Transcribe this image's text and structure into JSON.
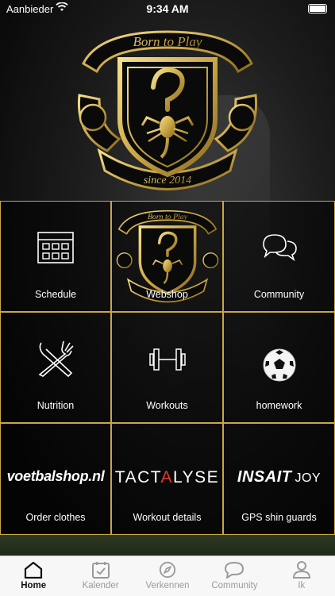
{
  "status_bar": {
    "carrier": "Aanbieder",
    "time": "9:34 AM"
  },
  "hero": {
    "logo_top_text": "Born to Play",
    "logo_bottom_text": "since 2014"
  },
  "tiles": [
    {
      "label": "Schedule",
      "icon": "calendar-icon"
    },
    {
      "label": "Webshop",
      "icon": "club-logo"
    },
    {
      "label": "Community",
      "icon": "chat-bubbles-icon"
    },
    {
      "label": "Nutrition",
      "icon": "fork-knife-icon"
    },
    {
      "label": "Workouts",
      "icon": "dumbbell-icon"
    },
    {
      "label": "homework",
      "icon": "soccer-ball-icon"
    },
    {
      "label": "Order clothes",
      "brand": "voetbalshop.nl"
    },
    {
      "label": "Workout details",
      "brand_parts": [
        "TACT",
        "A",
        "LYSE"
      ]
    },
    {
      "label": "GPS shin guards",
      "brand_parts": [
        "INSAIT",
        "JOY"
      ]
    }
  ],
  "tabbar": [
    {
      "label": "Home",
      "icon": "home-icon",
      "active": true
    },
    {
      "label": "Kalender",
      "icon": "calendar-check-icon"
    },
    {
      "label": "Verkennen",
      "icon": "compass-icon"
    },
    {
      "label": "Community",
      "icon": "chat-bubble-icon"
    },
    {
      "label": "Ik",
      "icon": "person-icon"
    }
  ],
  "colors": {
    "accent_gold": "#c9a646",
    "tab_active": "#111111",
    "tab_inactive": "#9a9a9a"
  }
}
